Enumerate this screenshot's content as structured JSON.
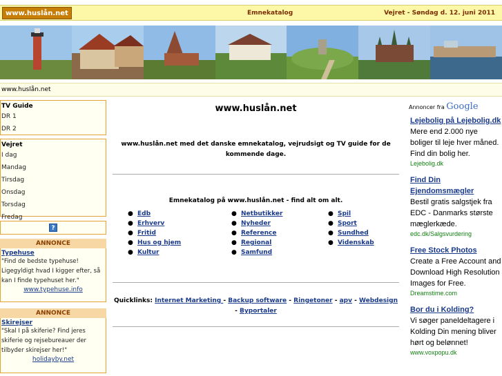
{
  "header": {
    "logo": "www.huslån.net",
    "center_title": "Emnekatalog",
    "right_text": "Vejret - Søndag d. 12. juni 2011"
  },
  "url_bar": "www.huslån.net",
  "tv_guide": {
    "heading": "TV Guide",
    "items": [
      "DR 1",
      "DR 2"
    ]
  },
  "weather": {
    "heading": "Vejret",
    "items": [
      "I dag",
      "Mandag",
      "Tirsdag",
      "Onsdag",
      "Torsdag",
      "Fredag"
    ]
  },
  "left_ads": [
    {
      "label": "ANNONCE",
      "title": "Typehuse",
      "text": "\"Find de bedste typehuse! Ligegyldigt hvad I kigger efter, så kan I finde typehuset her.\"",
      "url": "www.typehuse.info"
    },
    {
      "label": "ANNONCE",
      "title": "Skirejser",
      "text": "\"Skal I på skiferie? Find jeres skiferie og rejsebureauer der tilbyder skirejser her!\"",
      "url": "holidayby.net"
    }
  ],
  "main": {
    "title": "www.huslån.net",
    "intro": "www.huslån.net med det danske emnekatalog, vejrudsigt og TV guide for de kommende dage.",
    "catalog_heading": "Emnekatalog på www.huslån.net - find alt om alt.",
    "categories": [
      "Edb",
      "Netbutikker",
      "Spil",
      "Erhverv",
      "Nyheder",
      "Sport",
      "Fritid",
      "Reference",
      "Sundhed",
      "Hus og hjem",
      "Regional",
      "Videnskab",
      "Kultur",
      "Samfund"
    ],
    "quicklinks_label": "Quicklinks:",
    "quicklinks": [
      "Internet Marketing ",
      "Backup software",
      "Ringetoner",
      "apv",
      "Webdesign",
      "Byportaler"
    ]
  },
  "google_ads": {
    "label_prefix": "Annoncer fra",
    "label_brand": "Google",
    "ads": [
      {
        "title": "Lejebolig på Lejebolig.dk",
        "text": "Mere end 2.000 nye boliger til leje hver måned. Find din bolig her.",
        "url": "Lejebolig.dk"
      },
      {
        "title": "Find Din Ejendomsmægler",
        "text": "Bestil gratis salgstjek fra EDC - Danmarks største mæglerkæde.",
        "url": "edc.dk/Salgsvurdering"
      },
      {
        "title": "Free Stock Photos",
        "text": "Create a Free Account and Download High Resolution Images for Free.",
        "url": "Dreamstime.com"
      },
      {
        "title": "Bor du i Kolding?",
        "text": "Vi søger paneldeltagere i Kolding Din mening bliver hørt og belønnet!",
        "url": "www.voxpopu.dk"
      }
    ]
  },
  "colors": {
    "top_bar": "#fdf7a8",
    "logo_bg": "#c77e07",
    "box_border": "#e3a233",
    "annonce_bg": "#f7d8a4",
    "link": "#1a3a8a",
    "ad_url": "#118011"
  }
}
